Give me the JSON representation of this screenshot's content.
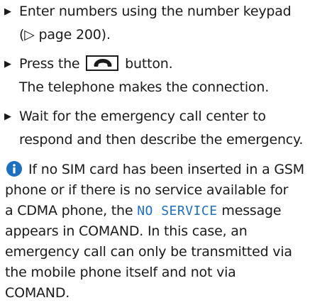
{
  "steps": [
    {
      "lines": [
        "Enter numbers using the number keypad",
        "(▷ page 200)."
      ]
    },
    {
      "line1_before": "Press the",
      "line1_after": "button.",
      "line2": "The telephone makes the connection.",
      "button_icon": "phone-handset-icon"
    },
    {
      "lines": [
        "Wait for the emergency call center to",
        "respond and then describe the emergency."
      ]
    }
  ],
  "note": {
    "icon": "info-icon",
    "line1": "If no SIM card has been inserted in a GSM",
    "line2": "phone or if there is no service available for",
    "line3_before": "a CDMA phone, the",
    "line3_code": "NO SERVICE",
    "line3_after": "message",
    "line4": "appears in COMAND. In this case, an",
    "line5": "emergency call can only be transmitted via",
    "line6": "the mobile phone itself and not via",
    "line7": "COMAND."
  },
  "colors": {
    "text": "#1a1a1a",
    "accent": "#1f6fbf"
  }
}
